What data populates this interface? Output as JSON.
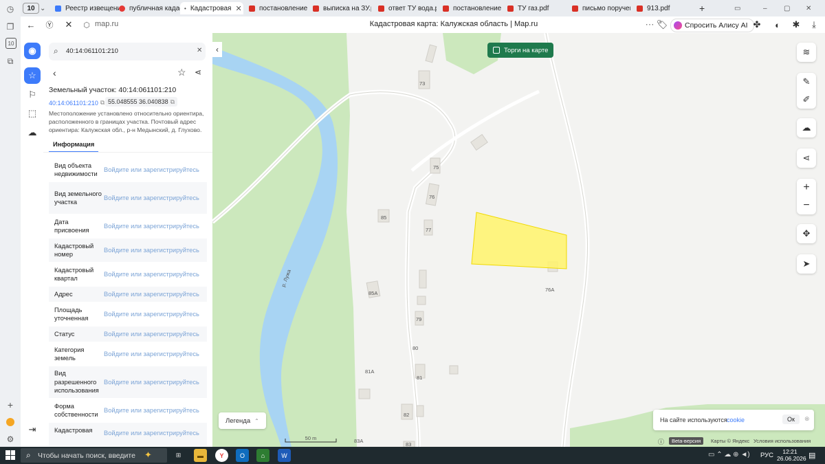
{
  "browser": {
    "tab_count": "10",
    "tabs": [
      {
        "label": "Реестр извещени",
        "icon": "document-icon"
      },
      {
        "label": "публичная кадас",
        "icon": "red-circle-icon"
      },
      {
        "label": "Кадастровая",
        "icon": "map-icon"
      },
      {
        "label": "постановление б",
        "icon": "pdf-icon"
      },
      {
        "label": "выписка на ЗУ.pc",
        "icon": "pdf-icon"
      },
      {
        "label": "ответ ТУ вода.pc",
        "icon": "pdf-icon"
      },
      {
        "label": "постановление б",
        "icon": "pdf-icon"
      },
      {
        "label": "ТУ газ.pdf",
        "icon": "pdf-icon"
      },
      {
        "label": "письмо поручен",
        "icon": "pdf-icon"
      },
      {
        "label": "913.pdf",
        "icon": "pdf-icon"
      }
    ],
    "url": "map.ru",
    "page_title": "Кадастровая карта: Калужская область | Map.ru",
    "alice_label": "Спросить Алису AI"
  },
  "panel": {
    "search_value": "40:14:061101:210",
    "heading": "Земельный участок: 40:14:061101:210",
    "cadastral_chip": "40:14:061101:210",
    "coords_chip": "55.048555 36.040838",
    "location_text": "Местоположение установлено относительно ориентира, расположенного в границах участка. Почтовый адрес ориентира: Калужская обл., р-н Медынский, д. Глухово.",
    "tab_info": "Информация",
    "rows": [
      {
        "label": "Вид объекта недвижимости",
        "value": "Войдите или зарегистрируйтесь"
      },
      {
        "label": "Вид земельного участка",
        "value": "Войдите или зарегистрируйтесь"
      },
      {
        "label": "Дата присвоения",
        "value": "Войдите или зарегистрируйтесь"
      },
      {
        "label": "Кадастровый номер",
        "value": "Войдите или зарегистрируйтесь"
      },
      {
        "label": "Кадастровый квартал",
        "value": "Войдите или зарегистрируйтесь"
      },
      {
        "label": "Адрес",
        "value": "Войдите или зарегистрируйтесь"
      },
      {
        "label": "Площадь уточненная",
        "value": "Войдите или зарегистрируйтесь"
      },
      {
        "label": "Статус",
        "value": "Войдите или зарегистрируйтесь"
      },
      {
        "label": "Категория земель",
        "value": "Войдите или зарегистрируйтесь"
      },
      {
        "label": "Вид разрешенного использования",
        "value": "Войдите или зарегистрируйтесь"
      },
      {
        "label": "Форма собственности",
        "value": "Войдите или зарегистрируйтесь"
      },
      {
        "label": "Кадастровая",
        "value": "Войдите или зарегистрируйтесь"
      }
    ]
  },
  "map": {
    "auction_toggle": "Торги на карте",
    "legend_button": "Легенда",
    "scale_label": "50 m",
    "river_label": "р. Лужа",
    "house_numbers": [
      "73",
      "75",
      "76",
      "85",
      "77",
      "76А",
      "85А",
      "79",
      "80",
      "81А",
      "81",
      "82",
      "83А",
      "83"
    ],
    "cookie_text": "На сайте используются",
    "cookie_link": "cookie",
    "cookie_ok": "Ок",
    "beta_badge": "Beta-версия",
    "credits": "Карты © Яндекс",
    "terms": "Условия использования"
  },
  "taskbar": {
    "search_placeholder": "Чтобы начать поиск, введите",
    "language": "РУС",
    "time": "12:21",
    "date": "26.06.2026"
  },
  "colors": {
    "accent_blue": "#3d7bfa",
    "parcel_fill": "#fff36b",
    "river": "#a8d4f3",
    "forest": "#cce8bd",
    "auction_green": "#1f7a4d"
  }
}
